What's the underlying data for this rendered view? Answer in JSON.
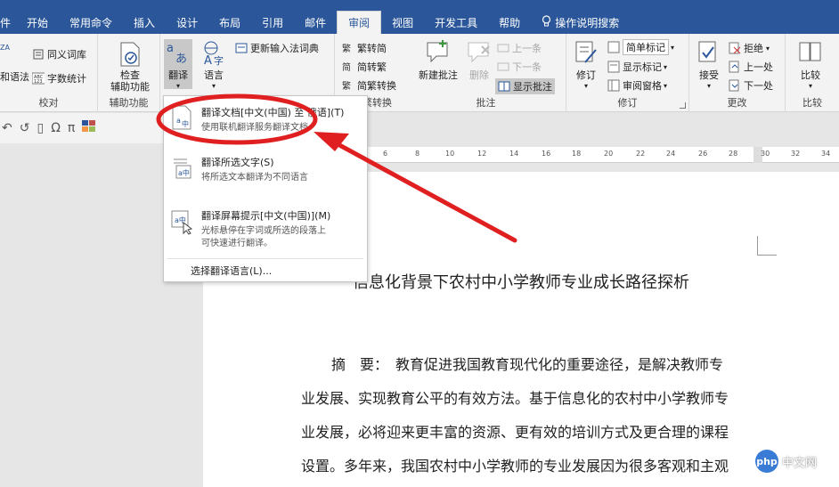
{
  "tabs": [
    {
      "label": "件"
    },
    {
      "label": "开始"
    },
    {
      "label": "常用命令"
    },
    {
      "label": "插入"
    },
    {
      "label": "设计"
    },
    {
      "label": "布局"
    },
    {
      "label": "引用"
    },
    {
      "label": "邮件"
    },
    {
      "label": "审阅"
    },
    {
      "label": "视图"
    },
    {
      "label": "开发工具"
    },
    {
      "label": "帮助"
    },
    {
      "label": "操作说明搜索"
    }
  ],
  "ribbon": {
    "proofing": {
      "spelling": "和语法",
      "thesaurus": "同义词库",
      "wordcount": "字数统计",
      "wordcount_badge": "ABC\n123",
      "label": "校对"
    },
    "accessibility": {
      "check": "检查\n辅助功能",
      "label": "辅助功能"
    },
    "language": {
      "translate": "翻译",
      "language": "语言",
      "update_ime": "更新输入法词典"
    },
    "chinese": {
      "to_simplified": "繁转简",
      "to_traditional": "简转繁",
      "convert": "简繁转换",
      "convert2": "简繁转换"
    },
    "comments": {
      "new": "新建批注",
      "delete": "删除",
      "prev": "上一条",
      "next": "下一条",
      "show": "显示批注",
      "label": "批注"
    },
    "tracking": {
      "track": "修订",
      "markup": "简单标记",
      "show_markup": "显示标记",
      "pane": "审阅窗格",
      "label": "修订"
    },
    "changes": {
      "accept": "接受",
      "reject": "拒绝",
      "prev": "上一处",
      "next": "下一处",
      "label": "更改"
    },
    "compare": {
      "compare": "比较",
      "label": "比较"
    }
  },
  "qat": [
    "↶",
    "↺",
    "▯",
    "Ω",
    "π"
  ],
  "ruler": [
    "6",
    "8",
    "10",
    "12",
    "14",
    "16",
    "18",
    "20",
    "22",
    "24",
    "26",
    "28",
    "30",
    "32",
    "34"
  ],
  "dropdown": {
    "items": [
      {
        "title": "翻译文档[中文(中国) 至 俄语](T)",
        "desc": "使用联机翻译服务翻译文档"
      },
      {
        "title": "翻译所选文字(S)",
        "desc": "将所选文本翻译为不同语言"
      },
      {
        "title": "翻译屏幕提示[中文(中国)](M)",
        "desc1": "光标悬停在字词或所选的段落上",
        "desc2": "可快速进行翻译。"
      }
    ],
    "footer": "选择翻译语言(L)..."
  },
  "document": {
    "title": "信息化背景下农村中小学教师专业成长路径探析",
    "lines": [
      "摘　要：　教育促进我国教育现代化的重要途径，是解决教师专",
      "业发展、实现教育公平的有效方法。基于信息化的农村中小学教师专",
      "业发展，必将迎来更丰富的资源、更有效的培训方式及更合理的课程",
      "设置。多年来，我国农村中小学教师的专业发展因为很多客观和主观"
    ]
  },
  "watermark": {
    "logo": "php",
    "text": "中文网"
  },
  "colors": {
    "accent": "#2b579a",
    "annotation": "#e02020"
  }
}
